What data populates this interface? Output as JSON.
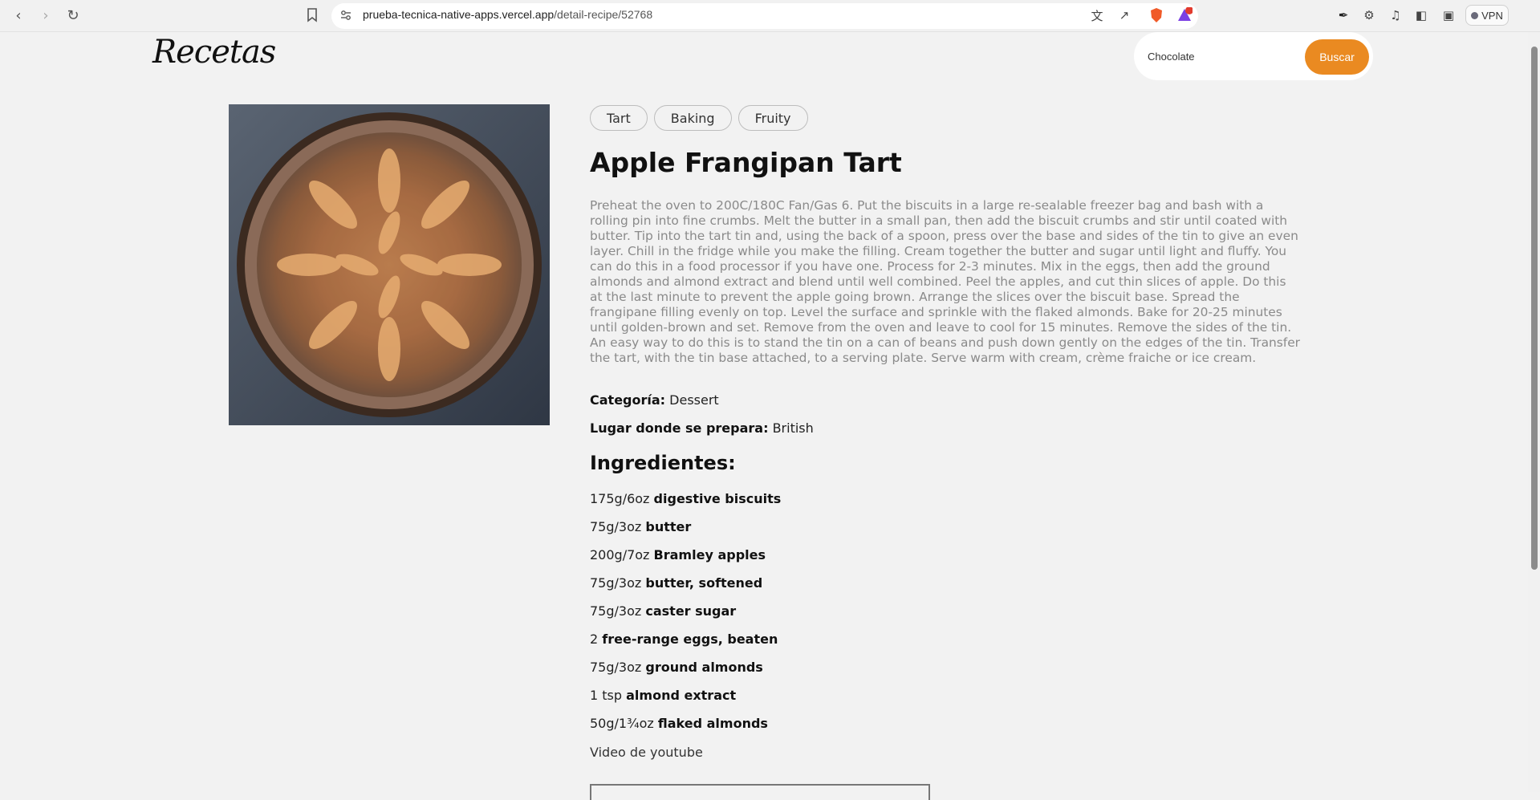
{
  "browser": {
    "url_domain": "prueba-tecnica-native-apps.vercel.app",
    "url_path": "/detail-recipe/52768",
    "vpn_label": "VPN",
    "notification_count": "1"
  },
  "header": {
    "logo": "Recetas",
    "search_value": "Chocolate",
    "search_button": "Buscar"
  },
  "recipe": {
    "tags": [
      "Tart",
      "Baking",
      "Fruity"
    ],
    "title": "Apple Frangipan Tart",
    "instructions": "Preheat the oven to 200C/180C Fan/Gas 6. Put the biscuits in a large re-sealable freezer bag and bash with a rolling pin into fine crumbs. Melt the butter in a small pan, then add the biscuit crumbs and stir until coated with butter. Tip into the tart tin and, using the back of a spoon, press over the base and sides of the tin to give an even layer. Chill in the fridge while you make the filling. Cream together the butter and sugar until light and fluffy. You can do this in a food processor if you have one. Process for 2-3 minutes. Mix in the eggs, then add the ground almonds and almond extract and blend until well combined. Peel the apples, and cut thin slices of apple. Do this at the last minute to prevent the apple going brown. Arrange the slices over the biscuit base. Spread the frangipane filling evenly on top. Level the surface and sprinkle with the flaked almonds. Bake for 20-25 minutes until golden-brown and set. Remove from the oven and leave to cool for 15 minutes. Remove the sides of the tin. An easy way to do this is to stand the tin on a can of beans and push down gently on the edges of the tin. Transfer the tart, with the tin base attached, to a serving plate. Serve warm with cream, crème fraiche or ice cream.",
    "category_label": "Categoría:",
    "category_value": "Dessert",
    "area_label": "Lugar donde se prepara:",
    "area_value": "British",
    "ingredients_heading": "Ingredientes:",
    "ingredients": [
      {
        "measure": "175g/6oz",
        "name": "digestive biscuits"
      },
      {
        "measure": "75g/3oz",
        "name": "butter"
      },
      {
        "measure": "200g/7oz",
        "name": "Bramley apples"
      },
      {
        "measure": "75g/3oz",
        "name": "butter, softened"
      },
      {
        "measure": "75g/3oz",
        "name": "caster sugar"
      },
      {
        "measure": "2",
        "name": "free-range eggs, beaten"
      },
      {
        "measure": "75g/3oz",
        "name": "ground almonds"
      },
      {
        "measure": "1 tsp",
        "name": "almond extract"
      },
      {
        "measure": "50g/1¾oz",
        "name": "flaked almonds"
      }
    ],
    "youtube_label": "Video de youtube"
  },
  "colors": {
    "accent": "#ea8a21",
    "background": "#f2f2f2",
    "instructions_text": "#8a8a8a"
  }
}
